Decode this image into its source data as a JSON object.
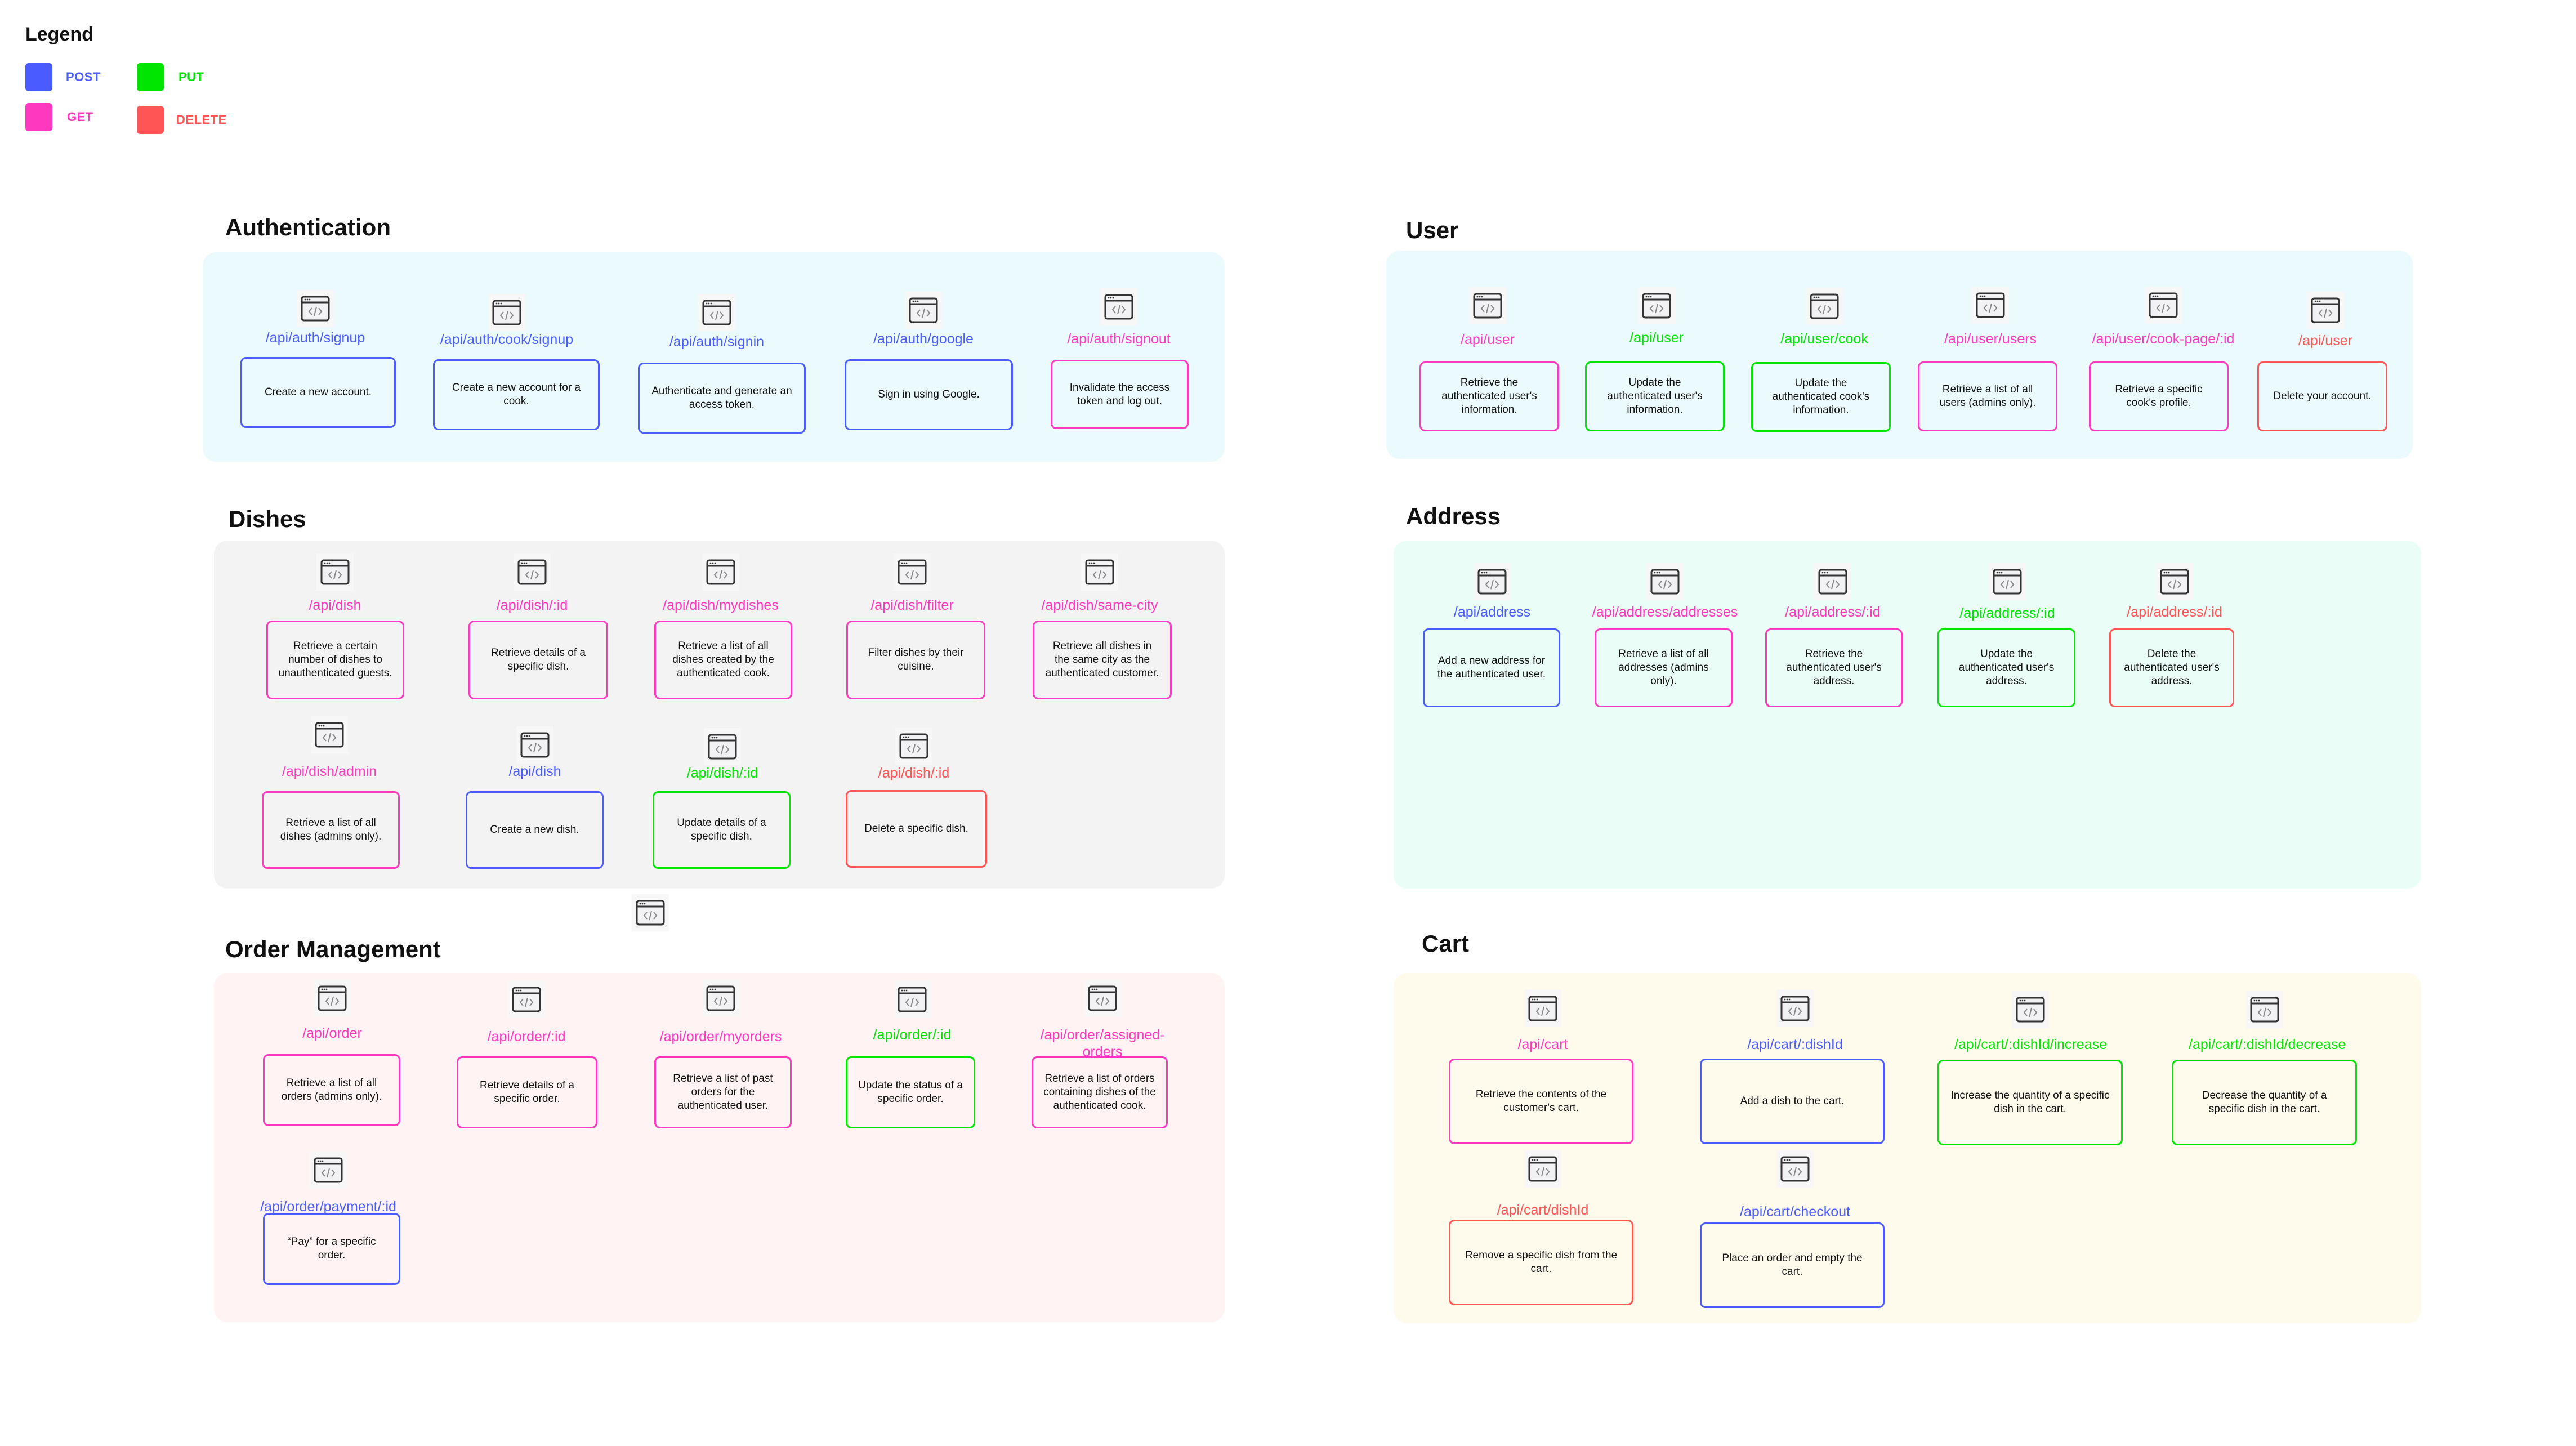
{
  "colors": {
    "POST": "#4a5cff",
    "GET": "#ff38c0",
    "PUT": "#00e600",
    "DELETE": "#ff5555"
  },
  "legend": {
    "title": "Legend",
    "items": [
      {
        "method": "POST",
        "label": "POST"
      },
      {
        "method": "PUT",
        "label": "PUT"
      },
      {
        "method": "GET",
        "label": "GET"
      },
      {
        "method": "DELETE",
        "label": "DELETE"
      }
    ]
  },
  "sections": [
    {
      "id": "authentication",
      "title": "Authentication",
      "background": "#ebfafd",
      "endpoints": [
        {
          "method": "POST",
          "path": "/api/auth/signup",
          "description": "Create a new account."
        },
        {
          "method": "POST",
          "path": "/api/auth/cook/signup",
          "description": "Create a new account for a cook."
        },
        {
          "method": "POST",
          "path": "/api/auth/signin",
          "description": "Authenticate and generate an access token."
        },
        {
          "method": "POST",
          "path": "/api/auth/google",
          "description": "Sign in using Google."
        },
        {
          "method": "GET",
          "path": "/api/auth/signout",
          "description": "Invalidate the access token and log out."
        }
      ]
    },
    {
      "id": "user",
      "title": "User",
      "background": "#ebfafd",
      "endpoints": [
        {
          "method": "GET",
          "path": "/api/user",
          "description": "Retrieve the authenticated user's information."
        },
        {
          "method": "PUT",
          "path": "/api/user",
          "description": "Update the authenticated user's information."
        },
        {
          "method": "PUT",
          "path": "/api/user/cook",
          "description": "Update the authenticated cook's information."
        },
        {
          "method": "GET",
          "path": "/api/user/users",
          "description": "Retrieve a list of all users (admins only)."
        },
        {
          "method": "GET",
          "path": "/api/user/cook-page/:id",
          "description": "Retrieve a specific cook's profile."
        },
        {
          "method": "DELETE",
          "path": "/api/user",
          "description": "Delete your account."
        }
      ]
    },
    {
      "id": "dishes",
      "title": "Dishes",
      "background": "#f3f3f3",
      "endpoints": [
        {
          "method": "GET",
          "path": "/api/dish",
          "description": "Retrieve a certain number of dishes to unauthenticated guests."
        },
        {
          "method": "GET",
          "path": "/api/dish/:id",
          "description": "Retrieve details of a specific dish."
        },
        {
          "method": "GET",
          "path": "/api/dish/mydishes",
          "description": "Retrieve a list of all dishes created by the authenticated cook."
        },
        {
          "method": "GET",
          "path": "/api/dish/filter",
          "description": "Filter dishes by their cuisine."
        },
        {
          "method": "GET",
          "path": "/api/dish/same-city",
          "description": "Retrieve all dishes in the same city as the authenticated customer."
        },
        {
          "method": "GET",
          "path": "/api/dish/admin",
          "description": "Retrieve a list of all dishes (admins only)."
        },
        {
          "method": "POST",
          "path": "/api/dish",
          "description": "Create a new dish."
        },
        {
          "method": "PUT",
          "path": "/api/dish/:id",
          "description": "Update details of a specific dish."
        },
        {
          "method": "DELETE",
          "path": "/api/dish/:id",
          "description": "Delete a specific dish."
        }
      ]
    },
    {
      "id": "address",
      "title": "Address",
      "background": "#eafdf6",
      "endpoints": [
        {
          "method": "POST",
          "path": "/api/address",
          "description": "Add a new address for the authenticated user."
        },
        {
          "method": "GET",
          "path": "/api/address/addresses",
          "description": "Retrieve a list of all addresses (admins only)."
        },
        {
          "method": "GET",
          "path": "/api/address/:id",
          "description": "Retrieve the authenticated user's address."
        },
        {
          "method": "PUT",
          "path": "/api/address/:id",
          "description": "Update the authenticated user's address."
        },
        {
          "method": "DELETE",
          "path": "/api/address/:id",
          "description": "Delete the authenticated user's address."
        }
      ]
    },
    {
      "id": "order-management",
      "title": "Order Management",
      "background": "#fff3f3",
      "endpoints": [
        {
          "method": "GET",
          "path": "/api/order",
          "description": "Retrieve a list of all orders (admins only)."
        },
        {
          "method": "GET",
          "path": "/api/order/:id",
          "description": "Retrieve details of a specific order."
        },
        {
          "method": "GET",
          "path": "/api/order/myorders",
          "description": "Retrieve a list of past orders for the authenticated user."
        },
        {
          "method": "PUT",
          "path": "/api/order/:id",
          "description": "Update the status of a specific order."
        },
        {
          "method": "GET",
          "path": "/api/order/assigned-orders",
          "description": "Retrieve a list of orders containing dishes of the authenticated cook."
        },
        {
          "method": "POST",
          "path": "/api/order/payment/:id",
          "description": "“Pay” for a specific order."
        }
      ]
    },
    {
      "id": "cart",
      "title": "Cart",
      "background": "#fefaec",
      "endpoints": [
        {
          "method": "GET",
          "path": "/api/cart",
          "description": "Retrieve the contents of the customer's cart."
        },
        {
          "method": "POST",
          "path": "/api/cart/:dishId",
          "description": "Add a dish to the cart."
        },
        {
          "method": "PUT",
          "path": "/api/cart/:dishId/increase",
          "description": "Increase the quantity of a specific dish in the cart."
        },
        {
          "method": "PUT",
          "path": "/api/cart/:dishId/decrease",
          "description": "Decrease the quantity of a specific dish in the cart."
        },
        {
          "method": "DELETE",
          "path": "/api/cart/dishId",
          "description": "Remove a specific dish from the cart."
        },
        {
          "method": "POST",
          "path": "/api/cart/checkout",
          "description": "Place an order and empty the cart."
        }
      ]
    }
  ]
}
